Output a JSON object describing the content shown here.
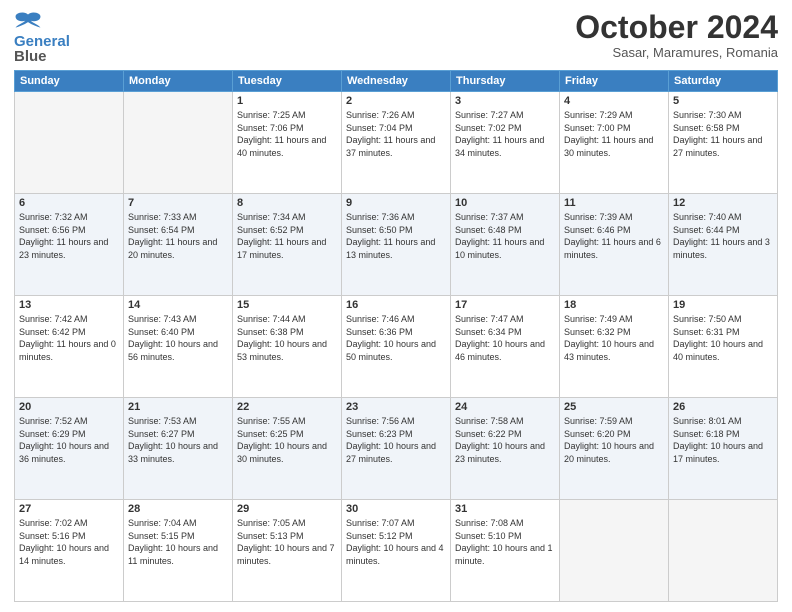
{
  "header": {
    "logo_line1": "General",
    "logo_line2": "Blue",
    "month": "October 2024",
    "location": "Sasar, Maramures, Romania"
  },
  "weekdays": [
    "Sunday",
    "Monday",
    "Tuesday",
    "Wednesday",
    "Thursday",
    "Friday",
    "Saturday"
  ],
  "weeks": [
    [
      {
        "day": "",
        "info": ""
      },
      {
        "day": "",
        "info": ""
      },
      {
        "day": "1",
        "info": "Sunrise: 7:25 AM\nSunset: 7:06 PM\nDaylight: 11 hours and 40 minutes."
      },
      {
        "day": "2",
        "info": "Sunrise: 7:26 AM\nSunset: 7:04 PM\nDaylight: 11 hours and 37 minutes."
      },
      {
        "day": "3",
        "info": "Sunrise: 7:27 AM\nSunset: 7:02 PM\nDaylight: 11 hours and 34 minutes."
      },
      {
        "day": "4",
        "info": "Sunrise: 7:29 AM\nSunset: 7:00 PM\nDaylight: 11 hours and 30 minutes."
      },
      {
        "day": "5",
        "info": "Sunrise: 7:30 AM\nSunset: 6:58 PM\nDaylight: 11 hours and 27 minutes."
      }
    ],
    [
      {
        "day": "6",
        "info": "Sunrise: 7:32 AM\nSunset: 6:56 PM\nDaylight: 11 hours and 23 minutes."
      },
      {
        "day": "7",
        "info": "Sunrise: 7:33 AM\nSunset: 6:54 PM\nDaylight: 11 hours and 20 minutes."
      },
      {
        "day": "8",
        "info": "Sunrise: 7:34 AM\nSunset: 6:52 PM\nDaylight: 11 hours and 17 minutes."
      },
      {
        "day": "9",
        "info": "Sunrise: 7:36 AM\nSunset: 6:50 PM\nDaylight: 11 hours and 13 minutes."
      },
      {
        "day": "10",
        "info": "Sunrise: 7:37 AM\nSunset: 6:48 PM\nDaylight: 11 hours and 10 minutes."
      },
      {
        "day": "11",
        "info": "Sunrise: 7:39 AM\nSunset: 6:46 PM\nDaylight: 11 hours and 6 minutes."
      },
      {
        "day": "12",
        "info": "Sunrise: 7:40 AM\nSunset: 6:44 PM\nDaylight: 11 hours and 3 minutes."
      }
    ],
    [
      {
        "day": "13",
        "info": "Sunrise: 7:42 AM\nSunset: 6:42 PM\nDaylight: 11 hours and 0 minutes."
      },
      {
        "day": "14",
        "info": "Sunrise: 7:43 AM\nSunset: 6:40 PM\nDaylight: 10 hours and 56 minutes."
      },
      {
        "day": "15",
        "info": "Sunrise: 7:44 AM\nSunset: 6:38 PM\nDaylight: 10 hours and 53 minutes."
      },
      {
        "day": "16",
        "info": "Sunrise: 7:46 AM\nSunset: 6:36 PM\nDaylight: 10 hours and 50 minutes."
      },
      {
        "day": "17",
        "info": "Sunrise: 7:47 AM\nSunset: 6:34 PM\nDaylight: 10 hours and 46 minutes."
      },
      {
        "day": "18",
        "info": "Sunrise: 7:49 AM\nSunset: 6:32 PM\nDaylight: 10 hours and 43 minutes."
      },
      {
        "day": "19",
        "info": "Sunrise: 7:50 AM\nSunset: 6:31 PM\nDaylight: 10 hours and 40 minutes."
      }
    ],
    [
      {
        "day": "20",
        "info": "Sunrise: 7:52 AM\nSunset: 6:29 PM\nDaylight: 10 hours and 36 minutes."
      },
      {
        "day": "21",
        "info": "Sunrise: 7:53 AM\nSunset: 6:27 PM\nDaylight: 10 hours and 33 minutes."
      },
      {
        "day": "22",
        "info": "Sunrise: 7:55 AM\nSunset: 6:25 PM\nDaylight: 10 hours and 30 minutes."
      },
      {
        "day": "23",
        "info": "Sunrise: 7:56 AM\nSunset: 6:23 PM\nDaylight: 10 hours and 27 minutes."
      },
      {
        "day": "24",
        "info": "Sunrise: 7:58 AM\nSunset: 6:22 PM\nDaylight: 10 hours and 23 minutes."
      },
      {
        "day": "25",
        "info": "Sunrise: 7:59 AM\nSunset: 6:20 PM\nDaylight: 10 hours and 20 minutes."
      },
      {
        "day": "26",
        "info": "Sunrise: 8:01 AM\nSunset: 6:18 PM\nDaylight: 10 hours and 17 minutes."
      }
    ],
    [
      {
        "day": "27",
        "info": "Sunrise: 7:02 AM\nSunset: 5:16 PM\nDaylight: 10 hours and 14 minutes."
      },
      {
        "day": "28",
        "info": "Sunrise: 7:04 AM\nSunset: 5:15 PM\nDaylight: 10 hours and 11 minutes."
      },
      {
        "day": "29",
        "info": "Sunrise: 7:05 AM\nSunset: 5:13 PM\nDaylight: 10 hours and 7 minutes."
      },
      {
        "day": "30",
        "info": "Sunrise: 7:07 AM\nSunset: 5:12 PM\nDaylight: 10 hours and 4 minutes."
      },
      {
        "day": "31",
        "info": "Sunrise: 7:08 AM\nSunset: 5:10 PM\nDaylight: 10 hours and 1 minute."
      },
      {
        "day": "",
        "info": ""
      },
      {
        "day": "",
        "info": ""
      }
    ]
  ]
}
